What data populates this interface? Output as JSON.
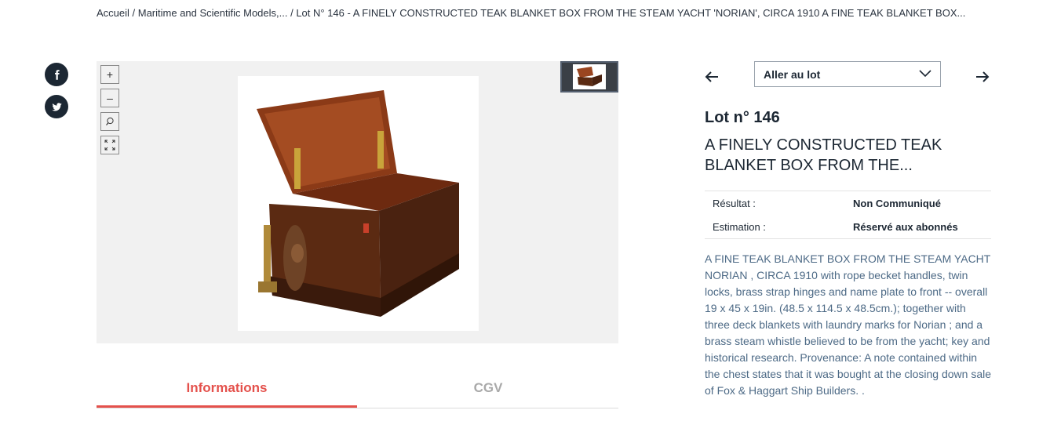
{
  "breadcrumb": "Accueil / Maritime and Scientific Models,... / Lot N°  146 - A FINELY CONSTRUCTED TEAK BLANKET BOX FROM THE STEAM YACHT 'NORIAN', CIRCA 1910 A FINE TEAK BLANKET BOX...",
  "social": {
    "facebook_icon": "facebook-icon",
    "twitter_icon": "twitter-icon"
  },
  "viewer": {
    "zoom_in": "+",
    "zoom_out": "–",
    "search_icon": "magnifier-icon",
    "fullscreen_icon": "expand-icon",
    "image_alt": "Teak blanket box"
  },
  "tabs": [
    {
      "label": "Informations",
      "active": true
    },
    {
      "label": "CGV",
      "active": false
    }
  ],
  "navigation": {
    "prev_icon": "arrow-left-icon",
    "next_icon": "arrow-right-icon",
    "select_label": "Aller au lot"
  },
  "lot": {
    "number": "Lot n° 146",
    "title": "A FINELY CONSTRUCTED TEAK BLANKET BOX FROM THE..."
  },
  "details": [
    {
      "key": "Résultat :",
      "value": "Non Communiqué"
    },
    {
      "key": "Estimation :",
      "value": "Réservé aux abonnés"
    }
  ],
  "description": "A FINE TEAK BLANKET BOX FROM THE STEAM YACHT NORIAN , CIRCA 1910 with rope becket handles, twin locks, brass strap hinges and name plate to front -- overall 19 x 45 x 19in. (48.5 x 114.5 x 48.5cm.); together with three deck blankets with laundry marks for Norian ; and a brass steam whistle believed to be from the yacht; key and historical research. Provenance: A note contained within the chest states that it was bought at the closing down sale of Fox & Haggart Ship Builders. .",
  "colors": {
    "accent": "#e4514c",
    "dark": "#1c2733",
    "desc_text": "#4d6a86"
  }
}
